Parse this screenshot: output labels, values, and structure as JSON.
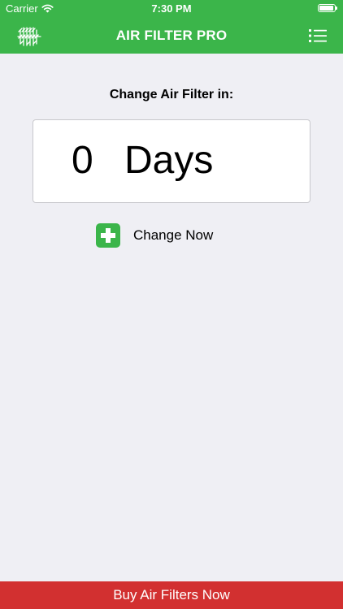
{
  "status_bar": {
    "carrier": "Carrier",
    "time": "7:30 PM",
    "wifi_icon": "wifi-icon",
    "battery_icon": "battery-icon"
  },
  "nav": {
    "title": "AIR FILTER PRO",
    "logo_icon": "air-filter-logo-icon",
    "menu_icon": "list-menu-icon"
  },
  "countdown": {
    "label": "Change Air Filter in:",
    "value": "0",
    "unit": "Days"
  },
  "change_now": {
    "label": "Change Now",
    "icon": "plus-icon"
  },
  "footer": {
    "buy_label": "Buy Air Filters Now"
  },
  "colors": {
    "brand_green": "#3bb54a",
    "buy_red": "#d23030",
    "background": "#efeff4"
  }
}
